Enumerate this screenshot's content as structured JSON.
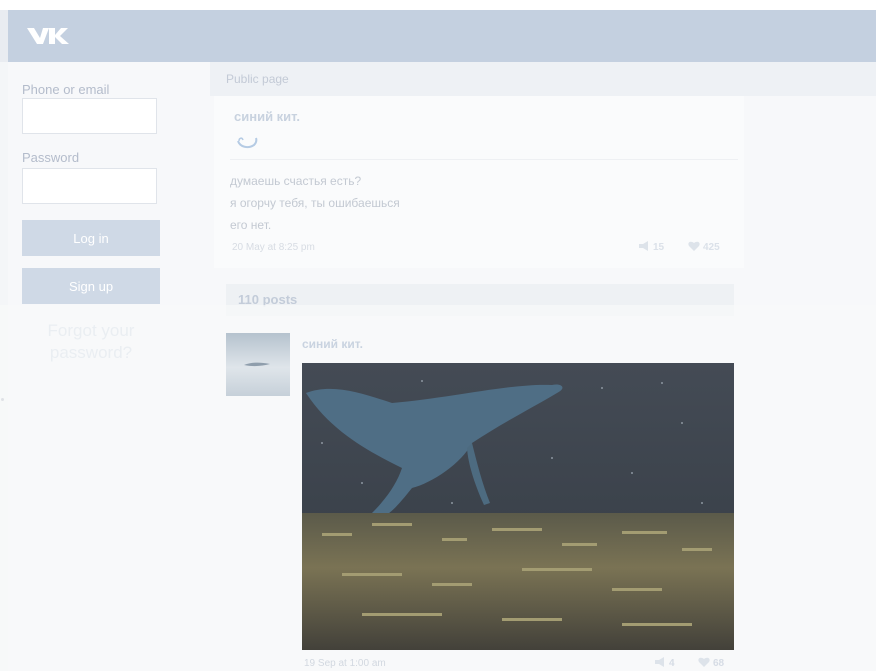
{
  "colors": {
    "header_bg": "#c4d0e0",
    "button_bg": "#cfd9e6",
    "label_text": "#b4bccb"
  },
  "header": {
    "logo_icon": "vk-logo-icon"
  },
  "login": {
    "email_label": "Phone or email",
    "email_value": "",
    "password_label": "Password",
    "password_value": "",
    "login_button": "Log in",
    "signup_button": "Sign up",
    "forgot_line1": "Forgot your",
    "forgot_line2": "password?"
  },
  "public_page": {
    "section_label": "Public page",
    "name": "синий кит.",
    "status_icon": "whale-icon",
    "status_lines": [
      "думаешь счастья есть?",
      "я огорчу тебя, ты ошибаешься",
      "его нет."
    ],
    "date": "20 May at 8:25 pm",
    "reposts": "15",
    "likes": "425"
  },
  "posts_count": "110 posts",
  "post": {
    "author": "синий кит.",
    "date": "19 Sep at 1:00 am",
    "reposts": "4",
    "likes": "68"
  }
}
